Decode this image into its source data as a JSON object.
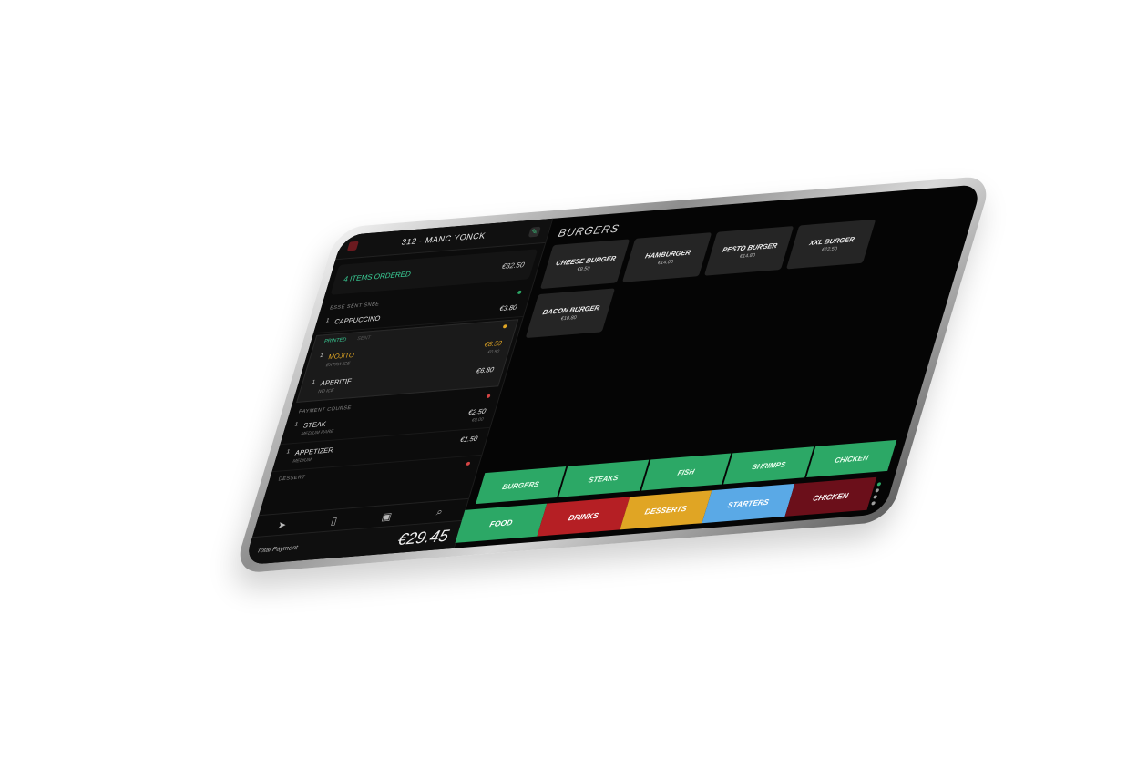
{
  "order": {
    "table_title": "312 - MANC YONCK",
    "summary_label": "4 ITEMS ORDERED",
    "summary_price": "€32.50",
    "groups": [
      {
        "label": "ESSE SENT SNBE",
        "status_color": "#2ca866",
        "items": [
          {
            "qty": "1",
            "name": "CAPPUCCINO",
            "note": "",
            "price": "€3.80",
            "note_price": ""
          }
        ]
      },
      {
        "label": "",
        "status_color": "#e0a524",
        "tabs": [
          "PRINTED",
          "SENT"
        ],
        "items": [
          {
            "qty": "1",
            "name": "MOJITO",
            "note": "EXTRA ICE",
            "price": "€8.50",
            "note_price": "€0.50"
          },
          {
            "qty": "1",
            "name": "APERITIF",
            "note": "NO ICE",
            "price": "€6.80",
            "note_price": ""
          }
        ]
      },
      {
        "label": "PAYMENT COURSE",
        "status_color": "#d64545",
        "items": [
          {
            "qty": "1",
            "name": "STEAK",
            "note": "MEDIUM RARE",
            "price": "€2.50",
            "note_price": "€0.00"
          },
          {
            "qty": "1",
            "name": "APPETIZER",
            "note": "MEDIUM",
            "price": "€1.50",
            "note_price": ""
          }
        ]
      },
      {
        "label": "DESSERT",
        "status_color": "#d64545",
        "items": []
      }
    ],
    "toolbar_icons": [
      "send-icon",
      "receipt-icon",
      "cash-icon",
      "search-icon"
    ],
    "total_label": "Total Payment",
    "total_value": "€29.45"
  },
  "menu": {
    "section_title": "BURGERS",
    "products": [
      {
        "name": "CHEESE BURGER",
        "price": "€9.50"
      },
      {
        "name": "HAMBURGER",
        "price": "€14.00"
      },
      {
        "name": "PESTO BURGER",
        "price": "€14.80"
      },
      {
        "name": "XXL BURGER",
        "price": "€22.50"
      },
      {
        "name": "BACON BURGER",
        "price": "€10.80"
      }
    ],
    "subcategories": [
      "BURGERS",
      "STEAKS",
      "FISH",
      "SHRIMPS",
      "CHICKEN"
    ],
    "categories": [
      {
        "label": "FOOD",
        "color": "#2ca866"
      },
      {
        "label": "DRINKS",
        "color": "#b51f24"
      },
      {
        "label": "DESSERTS",
        "color": "#e0a524"
      },
      {
        "label": "STARTERS",
        "color": "#5aa9e6"
      },
      {
        "label": "CHICKEN",
        "color": "#6b0f1a"
      }
    ]
  }
}
